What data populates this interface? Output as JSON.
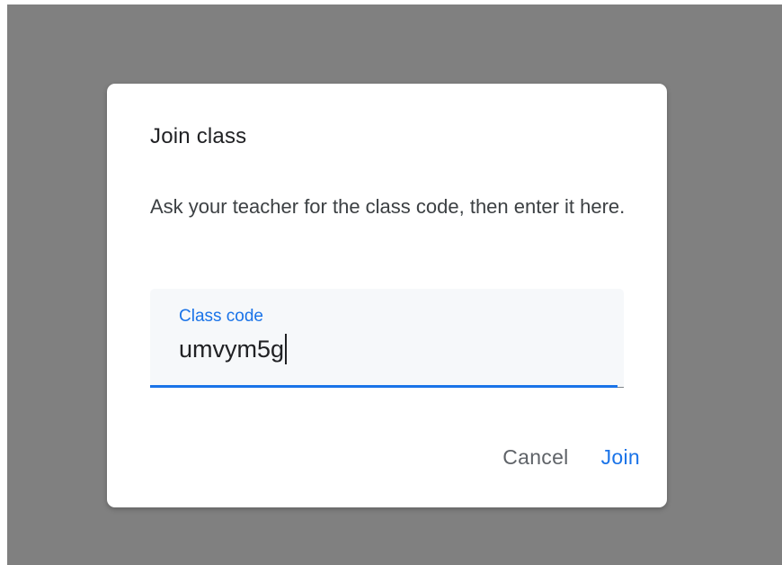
{
  "dialog": {
    "title": "Join class",
    "description": "Ask your teacher for the class code, then enter it here.",
    "field": {
      "label": "Class code",
      "value": "umvym5g"
    },
    "buttons": {
      "cancel": "Cancel",
      "join": "Join"
    }
  },
  "colors": {
    "overlay": "#808080",
    "accent": "#1a73e8",
    "field_background": "#f6f8fa"
  }
}
